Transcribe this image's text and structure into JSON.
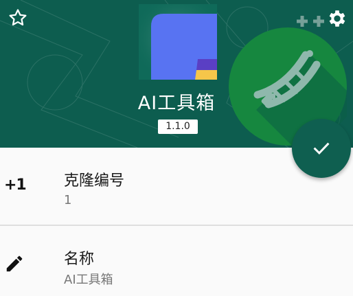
{
  "header": {
    "app_name": "AI工具箱",
    "version": "1.1.0",
    "background_color": "#0d5d4f",
    "icons": {
      "favorite": "star-outline-icon",
      "settings": "gear-icon",
      "watermark": "dna-icon",
      "app": "app-icon"
    }
  },
  "fab": {
    "icon": "check-icon",
    "color": "#0f5f50"
  },
  "fields": [
    {
      "icon": "plus-one-icon",
      "icon_text": "+1",
      "label": "克隆编号",
      "value": "1"
    },
    {
      "icon": "pencil-icon",
      "label": "名称",
      "value": "AI工具箱"
    }
  ]
}
